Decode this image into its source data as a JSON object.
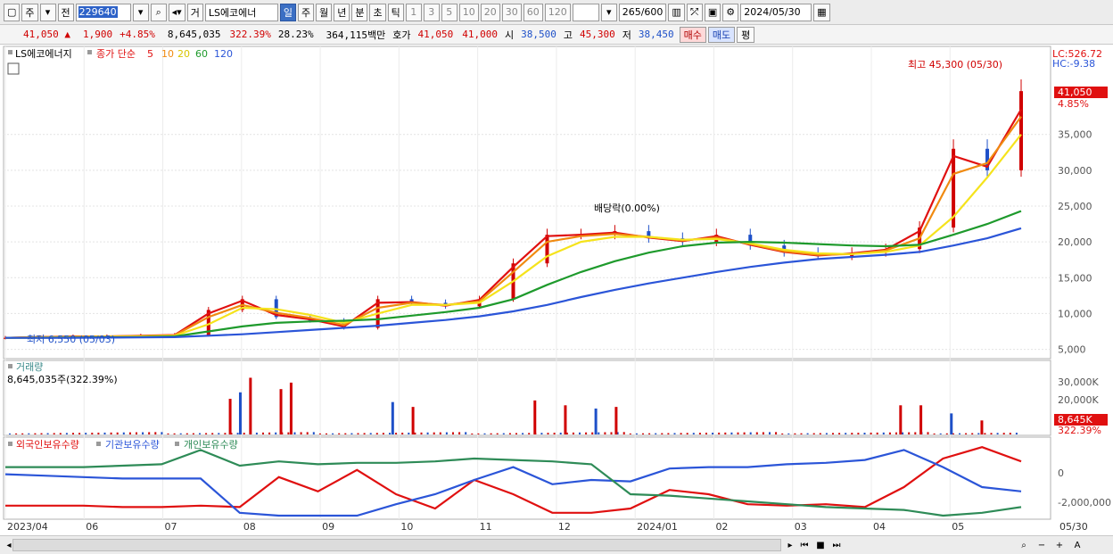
{
  "toolbar": {
    "market": "주",
    "prev": "전",
    "code": "229640",
    "geo_label": "거",
    "name": "LS에코에너",
    "periods": [
      "일",
      "주",
      "월",
      "년",
      "분",
      "초",
      "틱"
    ],
    "active_period": "일",
    "intervals": [
      "1",
      "3",
      "5",
      "10",
      "20",
      "30",
      "60",
      "120"
    ],
    "count": "265",
    "count_max": "/600",
    "date": "2024/05/30"
  },
  "quote": {
    "price": "41,050",
    "arrow": "▲",
    "change": "1,900",
    "change_pct": "+4.85%",
    "volume": "8,645,035",
    "vol_ratio": "322.39%",
    "turnover": "28.23%",
    "amount": "364,115백만",
    "bid_label": "호가",
    "bid1": "41,050",
    "bid2": "41,000",
    "open_label": "시",
    "open": "38,500",
    "high_label": "고",
    "high": "45,300",
    "low_label": "저",
    "low": "38,450",
    "buy": "매수",
    "sell": "매도",
    "avg": "평"
  },
  "legend": {
    "stock": "LS에코에너지",
    "ma_label": "종가 단순",
    "ma5": "5",
    "ma10": "10",
    "ma20": "20",
    "ma60": "60",
    "ma120": "120",
    "lc": "LC:526.72",
    "hc": "HC:-9.38",
    "high_note": "최고 45,300 (05/30)",
    "low_note": "최저 6,550 (05/03)",
    "dividend_note": "배당락(0.00%)",
    "price_tag": "41,050",
    "pct_tag": "4.85%"
  },
  "volume_panel": {
    "title": "거래량",
    "value": "8,645,035주(322.39%)",
    "tag": "8,645K",
    "tag_pct": "322.39%",
    "yticks": [
      "30,000K",
      "20,000K"
    ]
  },
  "holdings_panel": {
    "series": [
      "외국인보유수량",
      "기관보유수량",
      "개인보유수량"
    ],
    "yticks": [
      "0",
      "-2,000,000"
    ]
  },
  "colors": {
    "up": "#d00000",
    "down": "#1e50c8",
    "ma5": "#e01010",
    "ma10": "#f08a10",
    "ma20": "#f5e31c",
    "ma60": "#1e9a2c",
    "ma120": "#2b55d8",
    "foreign": "#e01010",
    "institution": "#2b55d8",
    "individual": "#2e8b57"
  },
  "chart_data": {
    "type": "line",
    "title": "LS에코에너지",
    "x_labels": [
      "2023/04",
      "06",
      "07",
      "08",
      "09",
      "10",
      "11",
      "12",
      "2024/01",
      "02",
      "03",
      "04",
      "05",
      "05/30"
    ],
    "y_ticks": [
      5000,
      10000,
      15000,
      20000,
      25000,
      30000,
      35000
    ],
    "ylim": [
      4200,
      46300
    ],
    "series": [
      {
        "name": "종가",
        "values": [
          6600,
          6700,
          6800,
          6800,
          6900,
          7000,
          10500,
          12000,
          9500,
          9000,
          8000,
          12000,
          11500,
          11000,
          12000,
          17000,
          21000,
          21000,
          21500,
          20500,
          20000,
          21000,
          19500,
          18500,
          18000,
          18500,
          19000,
          22000,
          33000,
          30000,
          41050
        ]
      },
      {
        "name": "5",
        "values": [
          6600,
          6700,
          6800,
          6800,
          6900,
          7000,
          10000,
          11800,
          9800,
          9200,
          8200,
          11500,
          11600,
          11100,
          11900,
          16500,
          20800,
          21000,
          21300,
          20600,
          20100,
          20800,
          19600,
          18600,
          18100,
          18400,
          18900,
          21500,
          32000,
          30500,
          38500
        ]
      },
      {
        "name": "10",
        "values": [
          6600,
          6700,
          6750,
          6800,
          6850,
          6950,
          9500,
          11200,
          10100,
          9400,
          8400,
          10800,
          11500,
          11200,
          11700,
          15800,
          20000,
          20800,
          21100,
          20700,
          20200,
          20600,
          19700,
          18700,
          18200,
          18300,
          18800,
          20500,
          29500,
          31000,
          37500
        ]
      },
      {
        "name": "20",
        "values": [
          6600,
          6650,
          6700,
          6750,
          6800,
          6900,
          8500,
          10800,
          10600,
          9800,
          8700,
          10000,
          11200,
          11200,
          11500,
          14500,
          18000,
          20000,
          20700,
          20700,
          20300,
          20400,
          19800,
          18900,
          18400,
          18300,
          18600,
          19500,
          23500,
          29000,
          35000
        ]
      },
      {
        "name": "60",
        "values": [
          6600,
          6620,
          6650,
          6680,
          6720,
          6800,
          7500,
          8200,
          8700,
          8900,
          9000,
          9200,
          9700,
          10200,
          10800,
          12000,
          14000,
          15800,
          17300,
          18500,
          19400,
          19900,
          20000,
          19900,
          19700,
          19500,
          19400,
          19600,
          21000,
          22500,
          24300
        ]
      },
      {
        "name": "120",
        "values": [
          6600,
          6610,
          6620,
          6640,
          6660,
          6700,
          6900,
          7100,
          7400,
          7700,
          8000,
          8300,
          8700,
          9100,
          9600,
          10300,
          11200,
          12300,
          13300,
          14200,
          15000,
          15800,
          16500,
          17100,
          17600,
          17900,
          18200,
          18600,
          19500,
          20500,
          21900
        ]
      }
    ],
    "volume_peaks_k": [
      22000,
      26000,
      35000,
      28000,
      32000,
      20000,
      17000,
      21000,
      18000,
      16000,
      17000,
      18000,
      18000,
      13000,
      8645
    ]
  }
}
